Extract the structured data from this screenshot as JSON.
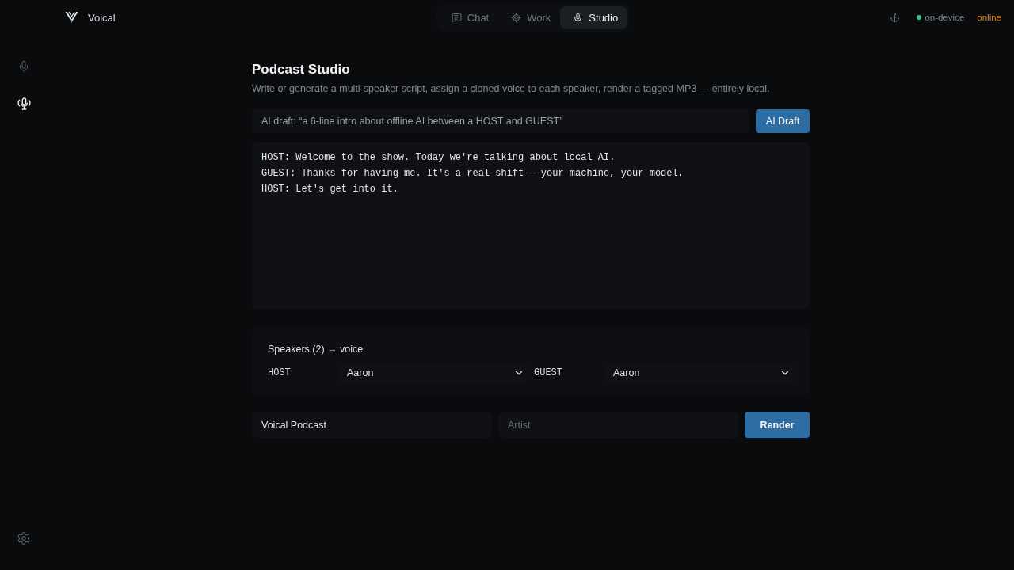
{
  "app": {
    "name": "Voical"
  },
  "tabs": [
    {
      "kind": "chat",
      "label": "Chat",
      "selected": false
    },
    {
      "kind": "work",
      "label": "Work",
      "selected": false
    },
    {
      "kind": "studio",
      "label": "Studio",
      "selected": true
    }
  ],
  "status": {
    "mode": "on-device",
    "connection": "online"
  },
  "sidebar": {
    "items": [
      {
        "kind": "mic",
        "selected": false
      },
      {
        "kind": "podcast",
        "selected": true
      }
    ]
  },
  "page": {
    "title": "Podcast Studio",
    "subtitle": "Write or generate a multi-speaker script, assign a cloned voice to each speaker, render a tagged MP3 — entirely local."
  },
  "draft": {
    "placeholder": "AI draft: “a 6-line intro about offline AI between a HOST and GUEST”",
    "button": "AI Draft"
  },
  "script": {
    "lines": [
      "HOST: Welcome to the show. Today we're talking about local AI.",
      "GUEST: Thanks for having me. It's a real shift — your machine, your model.",
      "HOST: Let's get into it."
    ]
  },
  "speakers": {
    "heading": "Speakers (2) → voice",
    "items": [
      {
        "name": "HOST",
        "voice": "Aaron"
      },
      {
        "name": "GUEST",
        "voice": "Aaron"
      }
    ]
  },
  "render": {
    "title": {
      "value": "Voical Podcast"
    },
    "artist": {
      "placeholder": "Artist"
    },
    "button": "Render"
  }
}
